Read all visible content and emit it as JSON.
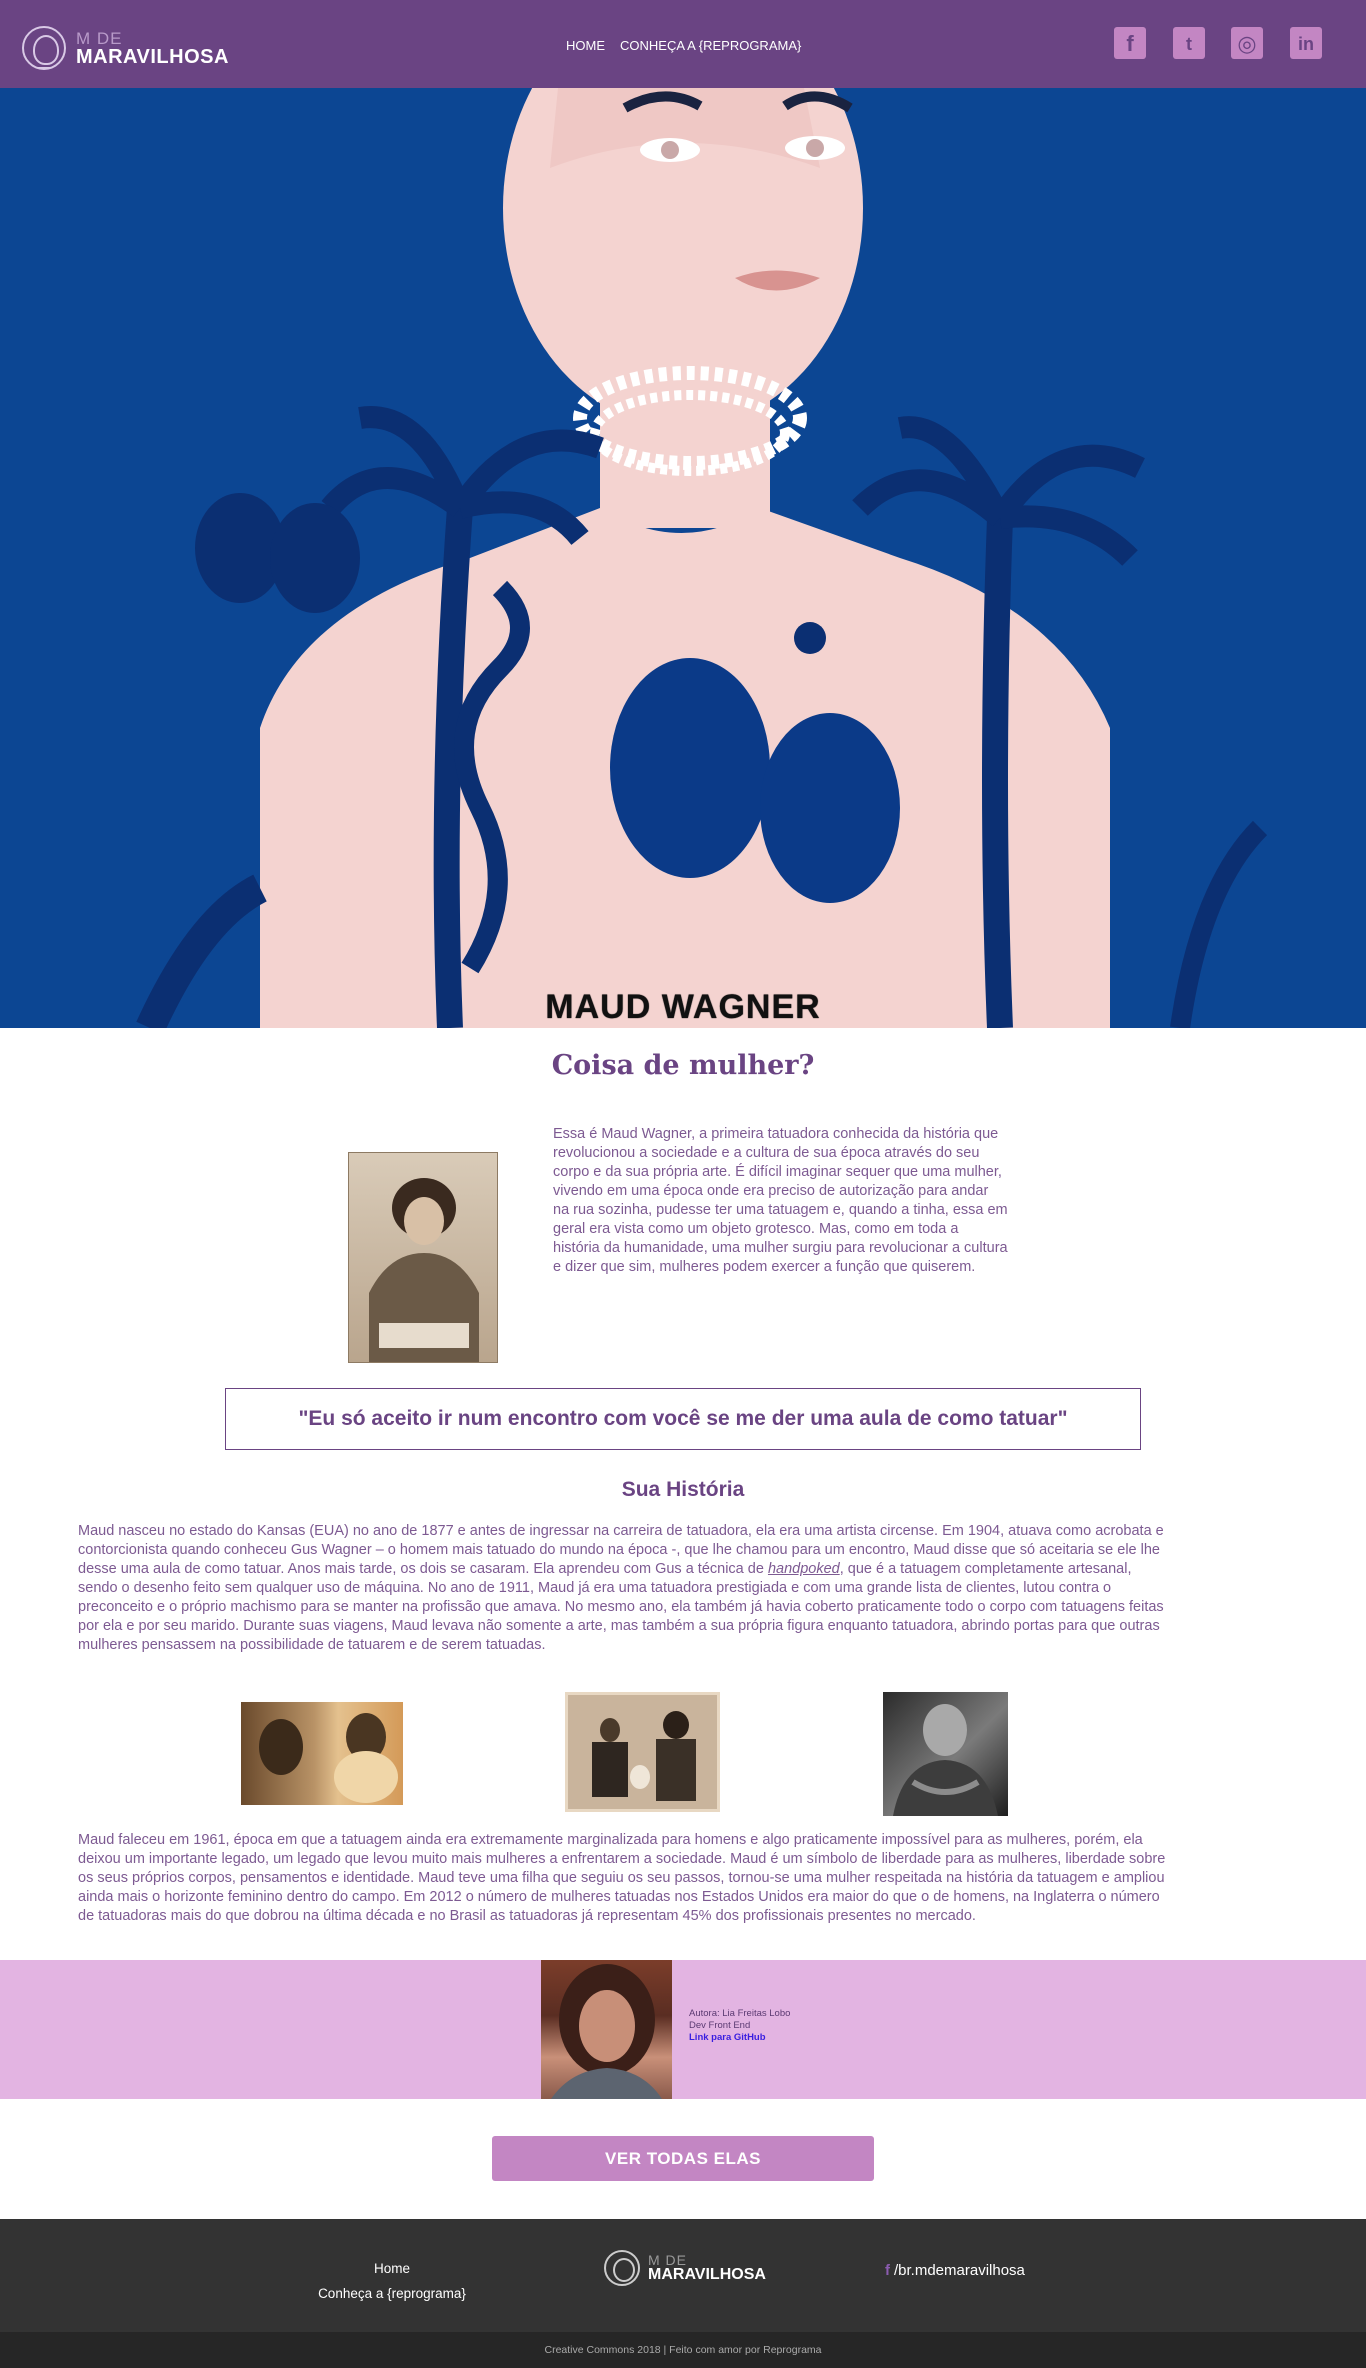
{
  "header": {
    "logo_line1": "M DE",
    "logo_line2": "MARAVILHOSA",
    "nav": [
      "HOME",
      "CONHEÇA A {REPROGRAMA}"
    ],
    "social": [
      {
        "icon": "facebook-icon",
        "glyph": "f"
      },
      {
        "icon": "twitter-icon",
        "glyph": "t"
      },
      {
        "icon": "instagram-icon",
        "glyph": "◎"
      },
      {
        "icon": "linkedin-icon",
        "glyph": "in"
      }
    ]
  },
  "hero": {
    "title": "MAUD WAGNER"
  },
  "main": {
    "subtitle": "Coisa de mulher?",
    "intro": "Essa é Maud Wagner, a primeira tatuadora conhecida da história que revolucionou a sociedade e a cultura de sua época através do seu corpo e da sua própria arte. É difícil imaginar sequer que uma mulher, vivendo em uma época onde era preciso de autorização para andar na rua sozinha, pudesse ter uma tatuagem e, quando a tinha, essa em geral era vista como um objeto grotesco. Mas, como em toda a história da humanidade, uma mulher surgiu para revolucionar a cultura e dizer que sim, mulheres podem exercer a função que quiserem.",
    "quote": "\"Eu só aceito ir num encontro com você se me der uma aula de como tatuar\"",
    "history_title": "Sua História",
    "history_p1_a": "Maud nasceu no estado do Kansas (EUA) no ano de 1877 e antes de ingressar na carreira de tatuadora, ela era uma artista circense. Em 1904, atuava como acrobata e contorcionista quando conheceu Gus Wagner – o homem mais tatuado do mundo na época -, que lhe chamou para um encontro, Maud disse que só aceitaria se ele lhe desse uma aula de como tatuar. Anos mais tarde, os dois se casaram. Ela aprendeu com Gus a técnica de ",
    "history_p1_em": "handpoked",
    "history_p1_b": ", que é a tatuagem completamente artesanal, sendo o desenho feito sem qualquer uso de máquina. No ano de 1911, Maud já era uma tatuadora prestigiada e com uma grande lista de clientes, lutou contra o preconceito e o próprio machismo para se manter na profissão que amava. No mesmo ano, ela também já havia coberto praticamente todo o corpo com tatuagens feitas por ela e por seu marido. Durante suas viagens, Maud levava não somente a arte, mas também a sua própria figura enquanto tatuadora, abrindo portas para que outras mulheres pensassem na possibilidade de tatuarem e de serem tatuadas.",
    "history_p2": "Maud faleceu em 1961, época em que a tatuagem ainda era extremamente marginalizada para homens e algo praticamente impossível para as mulheres, porém, ela deixou um importante legado, um legado que levou muito mais mulheres a enfrentarem a sociedade. Maud é um símbolo de liberdade para as mulheres, liberdade sobre os seus próprios corpos, pensamentos e identidade. Maud teve uma filha que seguiu os seu passos, tornou-se uma mulher respeitada na história da tatuagem e ampliou ainda mais o horizonte feminino dentro do campo. Em 2012 o número de mulheres tatuadas nos Estados Unidos era maior do que o de homens, na Inglaterra o número de tatuadoras mais do que dobrou na última década e no Brasil as tatuadoras já representam 45% dos profissionais presentes no mercado."
  },
  "author": {
    "name": "Autora: Lia Freitas Lobo",
    "role": "Dev Front End",
    "github": "Link para GitHub"
  },
  "cta": "VER TODAS ELAS",
  "footer": {
    "links": [
      "Home",
      "Conheça a {reprograma}"
    ],
    "logo_line1": "M DE",
    "logo_line2": "MARAVILHOSA",
    "facebook": "/br.mdemaravilhosa",
    "copyright": "Creative Commons 2018 | Feito com amor por Reprograma"
  },
  "colors": {
    "header_bg": "#6a4483",
    "accent": "#c386c3",
    "author_band": "#e3b4e2",
    "footer_bg": "#333333",
    "hero_bg": "#0c4693"
  }
}
